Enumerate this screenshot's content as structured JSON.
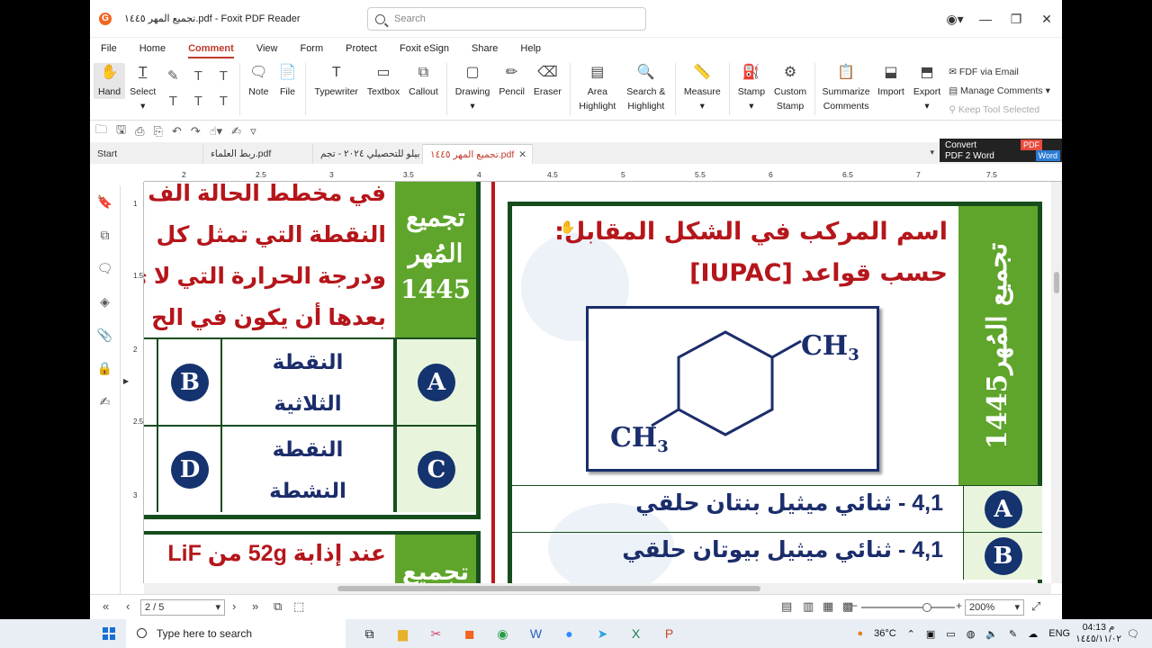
{
  "window": {
    "title": "تجميع المهر ١٤٤٥.pdf - Foxit PDF Reader",
    "search_placeholder": "Search"
  },
  "menu": [
    "File",
    "Home",
    "Comment",
    "View",
    "Form",
    "Protect",
    "Foxit eSign",
    "Share",
    "Help"
  ],
  "menu_active": "Comment",
  "ribbon": {
    "hand": "Hand",
    "select": "Select",
    "note": "Note",
    "file": "File",
    "typewriter": "Typewriter",
    "textbox": "Textbox",
    "callout": "Callout",
    "drawing": "Drawing",
    "pencil": "Pencil",
    "eraser": "Eraser",
    "area_highlight": "Area Highlight",
    "search_highlight": "Search & Highlight",
    "measure": "Measure",
    "stamp": "Stamp",
    "custom_stamp": "Custom Stamp",
    "summarize": "Summarize Comments",
    "import": "Import",
    "export": "Export",
    "fdf_email": "FDF via Email",
    "manage_comments": "Manage Comments",
    "keep_tool": "Keep Tool Selected"
  },
  "tabs": {
    "start": "Start",
    "tab1": "ربط العلماء.pdf",
    "tab2": "بيلو للتحصيلي ٢٠٢٤ - تجم",
    "tab3": "تجميع المهر ١٤٤٥.pdf",
    "convert_line1": "Convert",
    "convert_line2": "PDF 2 Word",
    "convert_pdf": "PDF",
    "convert_word": "Word"
  },
  "ruler_top": [
    "2",
    "2.5",
    "3",
    "3.5",
    "4",
    "4.5",
    "5",
    "5.5",
    "6",
    "6.5",
    "7",
    "7.5"
  ],
  "ruler_left": [
    "1",
    "1.5",
    "2",
    "2.5",
    "3"
  ],
  "status": {
    "page": "2 / 5",
    "zoom": "200%"
  },
  "pdf": {
    "right_title": "تجميع المُهر1445",
    "question": "اسم المركب في الشكل المقابل: حسب قواعد [IUPAC]",
    "ch3_top": "CH",
    "ch3_bottom": "CH",
    "sub3": "3",
    "option_a_label": "A",
    "option_a": "4,1 - ثنائي ميثيل بنتان حلقي",
    "option_b_label": "B",
    "option_b": "4,1 - ثنائي ميثيل بيوتان حلقي",
    "left_title_1": "تجميع",
    "left_title_2": "المُهر",
    "left_title_3": "1445",
    "left_q1": "في مخطط الحالة الف",
    "left_q2": "النقطة التي تمثل كل",
    "left_q3": "ودرجة الحرارة التي لا ي",
    "left_q4": "بعدها أن يكون في الح",
    "left_a_label": "A",
    "left_b_label": "B",
    "left_b_l1": "النقطة",
    "left_b_l2": "الثلاثية",
    "left_c_label": "C",
    "left_d_label": "D",
    "left_d_l1": "النقطة",
    "left_d_l2": "النشطة",
    "left2_text": "عند إذابة 52g من LiF",
    "left2_green": "تجميع"
  },
  "taskbar": {
    "search": "Type here to search",
    "temp": "36°C",
    "lang": "ENG",
    "time": "04:13 م",
    "date": "١٤٤٥/١١/٠٢"
  },
  "colors": {
    "accent": "#c0392b",
    "green": "#5fa52b",
    "dark_green": "#174d1d",
    "navy": "#14336f",
    "red_text": "#b5161b"
  }
}
